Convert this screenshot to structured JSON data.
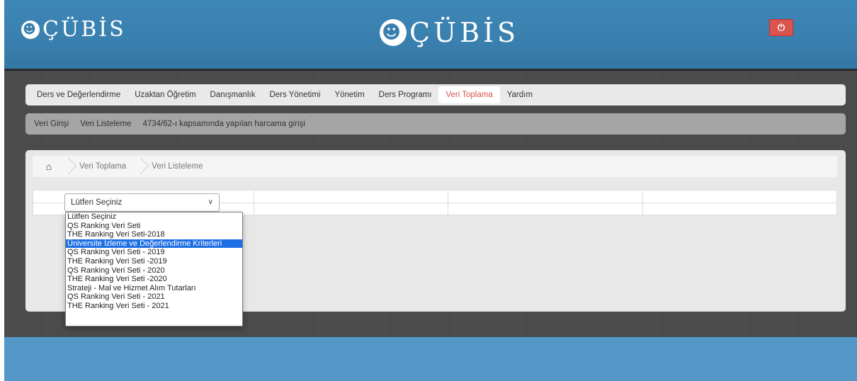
{
  "brand": {
    "logo_text": "ÇÜBİS",
    "logo_text_left": "ÇÜBİS"
  },
  "main_nav": {
    "items": [
      {
        "label": "Ders ve Değerlendirme"
      },
      {
        "label": "Uzaktan Öğretim"
      },
      {
        "label": "Danışmanlık"
      },
      {
        "label": "Ders Yönetimi"
      },
      {
        "label": "Yönetim"
      },
      {
        "label": "Ders Programı"
      },
      {
        "label": "Veri Toplama",
        "active": true
      },
      {
        "label": "Yardım"
      }
    ]
  },
  "sub_nav": {
    "items": [
      {
        "label": "Veri Girişi"
      },
      {
        "label": "Veri Listeleme"
      },
      {
        "label": "4734/62-ı kapsamında yapılan harcama girişi"
      }
    ]
  },
  "breadcrumb": {
    "items": [
      {
        "label": "Veri Toplama"
      },
      {
        "label": "Veri Listeleme"
      }
    ]
  },
  "select": {
    "value": "Lütfen Seçiniz",
    "options": [
      "Lütfen Seçiniz",
      "QS Ranking Veri Seti",
      "THE Ranking Veri Seti-2018",
      "Üniversite İzleme ve Değerlendirme Kriterleri",
      "QS Ranking Veri Seti - 2019",
      "THE Ranking Veri Seti -2019",
      "QS Ranking Veri Seti - 2020",
      "THE Ranking Veri Seti -2020",
      "Strateji - Mal ve Hizmet Alım Tutarları",
      "QS Ranking Veri Seti - 2021",
      "THE Ranking Veri Seti - 2021"
    ],
    "highlighted_index": 3
  },
  "colors": {
    "header_blue": "#3a80ae",
    "active_red": "#d9534f",
    "highlight_blue": "#1e6fe4"
  }
}
